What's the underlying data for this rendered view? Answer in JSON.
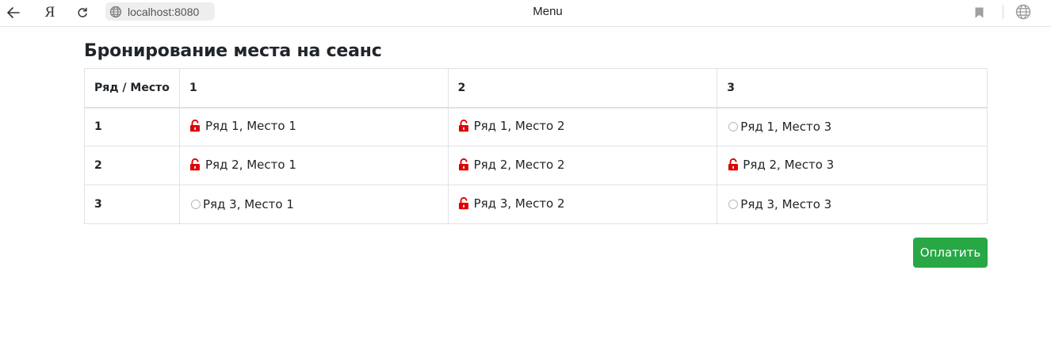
{
  "browser": {
    "url": "localhost:8080",
    "tab_title": "Menu",
    "logo_letter": "Я"
  },
  "colors": {
    "locked_seat": "#e00000",
    "pay_button": "#28a745"
  },
  "page": {
    "title": "Бронирование места на сеанс"
  },
  "table": {
    "corner_header": "Ряд / Место",
    "columns": [
      "1",
      "2",
      "3"
    ],
    "rows": [
      {
        "label": "1",
        "cells": [
          {
            "text": "Ряд 1, Место 1",
            "icon": "unlock-icon"
          },
          {
            "text": "Ряд 1, Место 2",
            "icon": "unlock-icon"
          },
          {
            "text": "Ряд 1, Место 3",
            "icon": "radio-icon"
          }
        ]
      },
      {
        "label": "2",
        "cells": [
          {
            "text": "Ряд 2, Место 1",
            "icon": "unlock-icon"
          },
          {
            "text": "Ряд 2, Место 2",
            "icon": "unlock-icon"
          },
          {
            "text": "Ряд 2, Место 3",
            "icon": "unlock-icon"
          }
        ]
      },
      {
        "label": "3",
        "cells": [
          {
            "text": "Ряд 3, Место 1",
            "icon": "radio-icon"
          },
          {
            "text": "Ряд 3, Место 2",
            "icon": "unlock-icon"
          },
          {
            "text": "Ряд 3, Место 3",
            "icon": "radio-icon"
          }
        ]
      }
    ]
  },
  "actions": {
    "pay_label": "Оплатить"
  }
}
